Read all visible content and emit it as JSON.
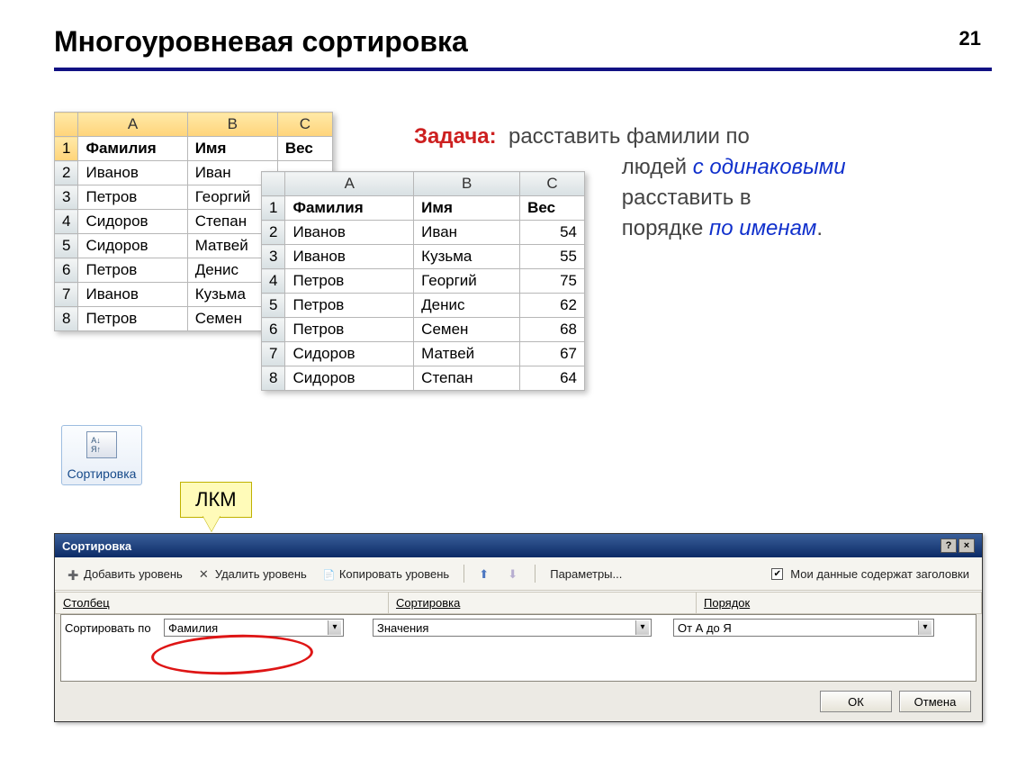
{
  "page_number": "21",
  "title": "Многоуровневая сортировка",
  "task": {
    "label": "Задача:",
    "text1": "расставить фамилии по",
    "text2": "людей",
    "em1": "с одинаковыми",
    "text3": "расставить в",
    "text4": "порядке",
    "em2": "по именам",
    "period": "."
  },
  "table1": {
    "cols": [
      "A",
      "B",
      "C"
    ],
    "headers": [
      "Фамилия",
      "Имя",
      "Вес"
    ],
    "rows": [
      {
        "n": "2",
        "a": "Иванов",
        "b": "Иван"
      },
      {
        "n": "3",
        "a": "Петров",
        "b": "Георгий"
      },
      {
        "n": "4",
        "a": "Сидоров",
        "b": "Степан"
      },
      {
        "n": "5",
        "a": "Сидоров",
        "b": "Матвей"
      },
      {
        "n": "6",
        "a": "Петров",
        "b": "Денис"
      },
      {
        "n": "7",
        "a": "Иванов",
        "b": "Кузьма"
      },
      {
        "n": "8",
        "a": "Петров",
        "b": "Семен"
      }
    ]
  },
  "table2": {
    "cols": [
      "A",
      "B",
      "C"
    ],
    "headers": [
      "Фамилия",
      "Имя",
      "Вес"
    ],
    "rows": [
      {
        "n": "2",
        "a": "Иванов",
        "b": "Иван",
        "c": "54"
      },
      {
        "n": "3",
        "a": "Иванов",
        "b": "Кузьма",
        "c": "55"
      },
      {
        "n": "4",
        "a": "Петров",
        "b": "Георгий",
        "c": "75"
      },
      {
        "n": "5",
        "a": "Петров",
        "b": "Денис",
        "c": "62"
      },
      {
        "n": "6",
        "a": "Петров",
        "b": "Семен",
        "c": "68"
      },
      {
        "n": "7",
        "a": "Сидоров",
        "b": "Матвей",
        "c": "67"
      },
      {
        "n": "8",
        "a": "Сидоров",
        "b": "Степан",
        "c": "64"
      }
    ]
  },
  "sort_button_label": "Сортировка",
  "lkm_label": "ЛКМ",
  "dialog": {
    "title": "Сортировка",
    "toolbar": {
      "add": "Добавить уровень",
      "del": "Удалить уровень",
      "copy": "Копировать уровень",
      "params": "Параметры...",
      "check": "Мои данные содержат заголовки"
    },
    "columns": {
      "c1": "Столбец",
      "c2": "Сортировка",
      "c3": "Порядок"
    },
    "row": {
      "label": "Сортировать по",
      "col": "Фамилия",
      "sort": "Значения",
      "order": "От А до Я"
    },
    "ok": "ОК",
    "cancel": "Отмена"
  }
}
